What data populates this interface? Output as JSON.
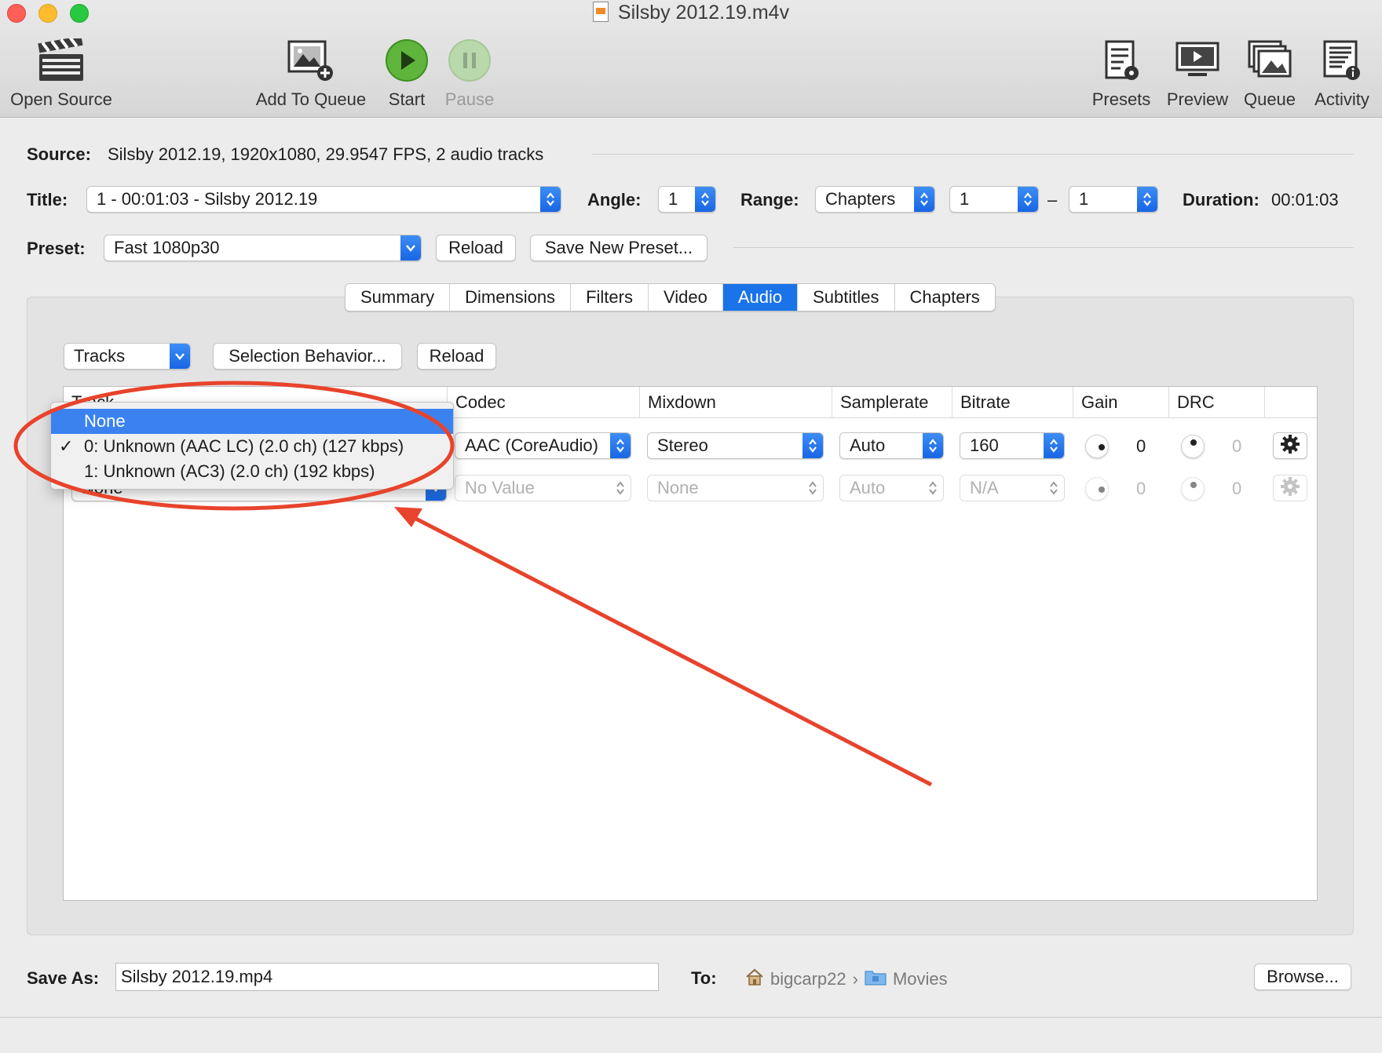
{
  "window": {
    "title": "Silsby 2012.19.m4v"
  },
  "toolbar": {
    "open_source": "Open Source",
    "add_to_queue": "Add To Queue",
    "start": "Start",
    "pause": "Pause",
    "presets": "Presets",
    "preview": "Preview",
    "queue": "Queue",
    "activity": "Activity"
  },
  "source": {
    "label": "Source:",
    "value": "Silsby 2012.19, 1920x1080, 29.9547 FPS, 2 audio tracks"
  },
  "title_row": {
    "label": "Title:",
    "value": "1 - 00:01:03 - Silsby 2012.19",
    "angle_label": "Angle:",
    "angle": "1",
    "range_label": "Range:",
    "range": "Chapters",
    "range_start": "1",
    "range_dash": "–",
    "range_end": "1",
    "duration_label": "Duration:",
    "duration": "00:01:03"
  },
  "preset_row": {
    "label": "Preset:",
    "value": "Fast 1080p30",
    "reload": "Reload",
    "save_new": "Save New Preset..."
  },
  "tabs": [
    "Summary",
    "Dimensions",
    "Filters",
    "Video",
    "Audio",
    "Subtitles",
    "Chapters"
  ],
  "active_tab": "Audio",
  "audio": {
    "tracks_button": "Tracks",
    "selection_behavior": "Selection Behavior...",
    "reload": "Reload",
    "columns": {
      "track": "Track",
      "codec": "Codec",
      "mixdown": "Mixdown",
      "samplerate": "Samplerate",
      "bitrate": "Bitrate",
      "gain": "Gain",
      "drc": "DRC"
    },
    "row1": {
      "codec": "AAC (CoreAudio)",
      "mixdown": "Stereo",
      "samplerate": "Auto",
      "bitrate": "160",
      "gain": "0",
      "drc": "0"
    },
    "row2": {
      "track": "None",
      "codec": "No Value",
      "mixdown": "None",
      "samplerate": "Auto",
      "bitrate": "N/A",
      "gain": "0",
      "drc": "0"
    }
  },
  "track_menu": {
    "items": [
      "None",
      "0: Unknown (AAC LC) (2.0 ch) (127 kbps)",
      "1: Unknown (AC3) (2.0 ch) (192 kbps)"
    ],
    "highlighted": "None",
    "checked": "0: Unknown (AAC LC) (2.0 ch) (127 kbps)",
    "check_mark": "✓"
  },
  "bottom": {
    "save_as_label": "Save As:",
    "save_as": "Silsby 2012.19.mp4",
    "to_label": "To:",
    "path_home": "bigcarp22",
    "path_sep": "›",
    "path_folder": "Movies",
    "browse": "Browse..."
  },
  "annotation_color": "#e8432c",
  "accent": "#1a73e8"
}
